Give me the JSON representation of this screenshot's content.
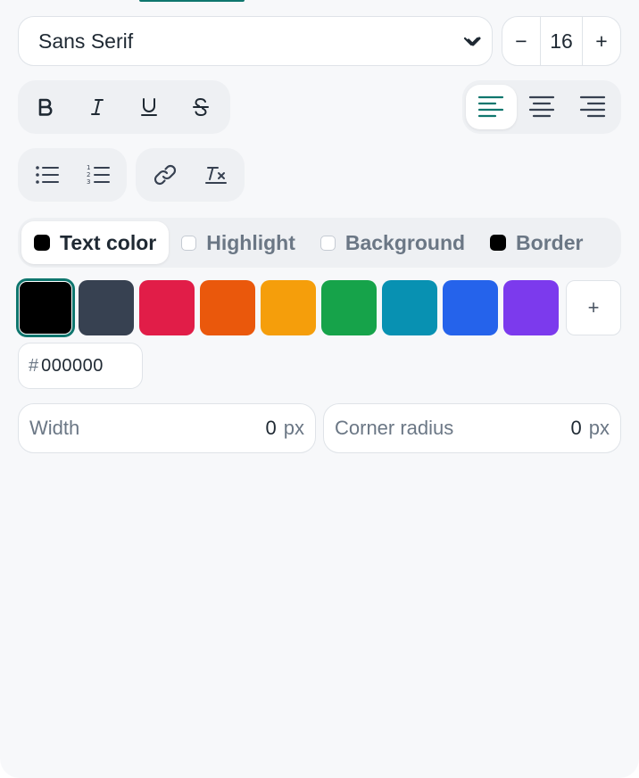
{
  "font": {
    "family": "Sans Serif"
  },
  "size": {
    "minus": "−",
    "value": "16",
    "plus": "+"
  },
  "format_buttons": [
    {
      "name": "bold-icon",
      "icon": "bold"
    },
    {
      "name": "italic-icon",
      "icon": "italic"
    },
    {
      "name": "underline-icon",
      "icon": "underline"
    },
    {
      "name": "strikethrough-icon",
      "icon": "strikethrough"
    }
  ],
  "align_buttons": [
    {
      "name": "align-left-icon",
      "active": true
    },
    {
      "name": "align-center-icon",
      "active": false
    },
    {
      "name": "align-right-icon",
      "active": false
    }
  ],
  "target_tabs": [
    {
      "label": "Text color",
      "indicator": "filled",
      "active": true
    },
    {
      "label": "Highlight",
      "indicator": "empty",
      "active": false
    },
    {
      "label": "Background",
      "indicator": "empty",
      "active": false
    },
    {
      "label": "Border",
      "indicator": "filled",
      "active": false
    }
  ],
  "swatches": [
    {
      "color": "#000000",
      "selected": true
    },
    {
      "color": "#374151",
      "selected": false
    },
    {
      "color": "#e11d48",
      "selected": false
    },
    {
      "color": "#ea580c",
      "selected": false
    },
    {
      "color": "#f59e0b",
      "selected": false
    },
    {
      "color": "#16a34a",
      "selected": false
    },
    {
      "color": "#0891b2",
      "selected": false
    },
    {
      "color": "#2563eb",
      "selected": false
    },
    {
      "color": "#7c3aed",
      "selected": false
    }
  ],
  "add_swatch": "+",
  "hex": {
    "prefix": "#",
    "value": "000000"
  },
  "border_width": {
    "label": "Width",
    "value": "0",
    "unit": "px"
  },
  "corner_radius": {
    "label": "Corner radius",
    "value": "0",
    "unit": "px"
  },
  "colors": {
    "accent": "#0f766e",
    "text": "#1f2933",
    "muted": "#6b7785"
  }
}
